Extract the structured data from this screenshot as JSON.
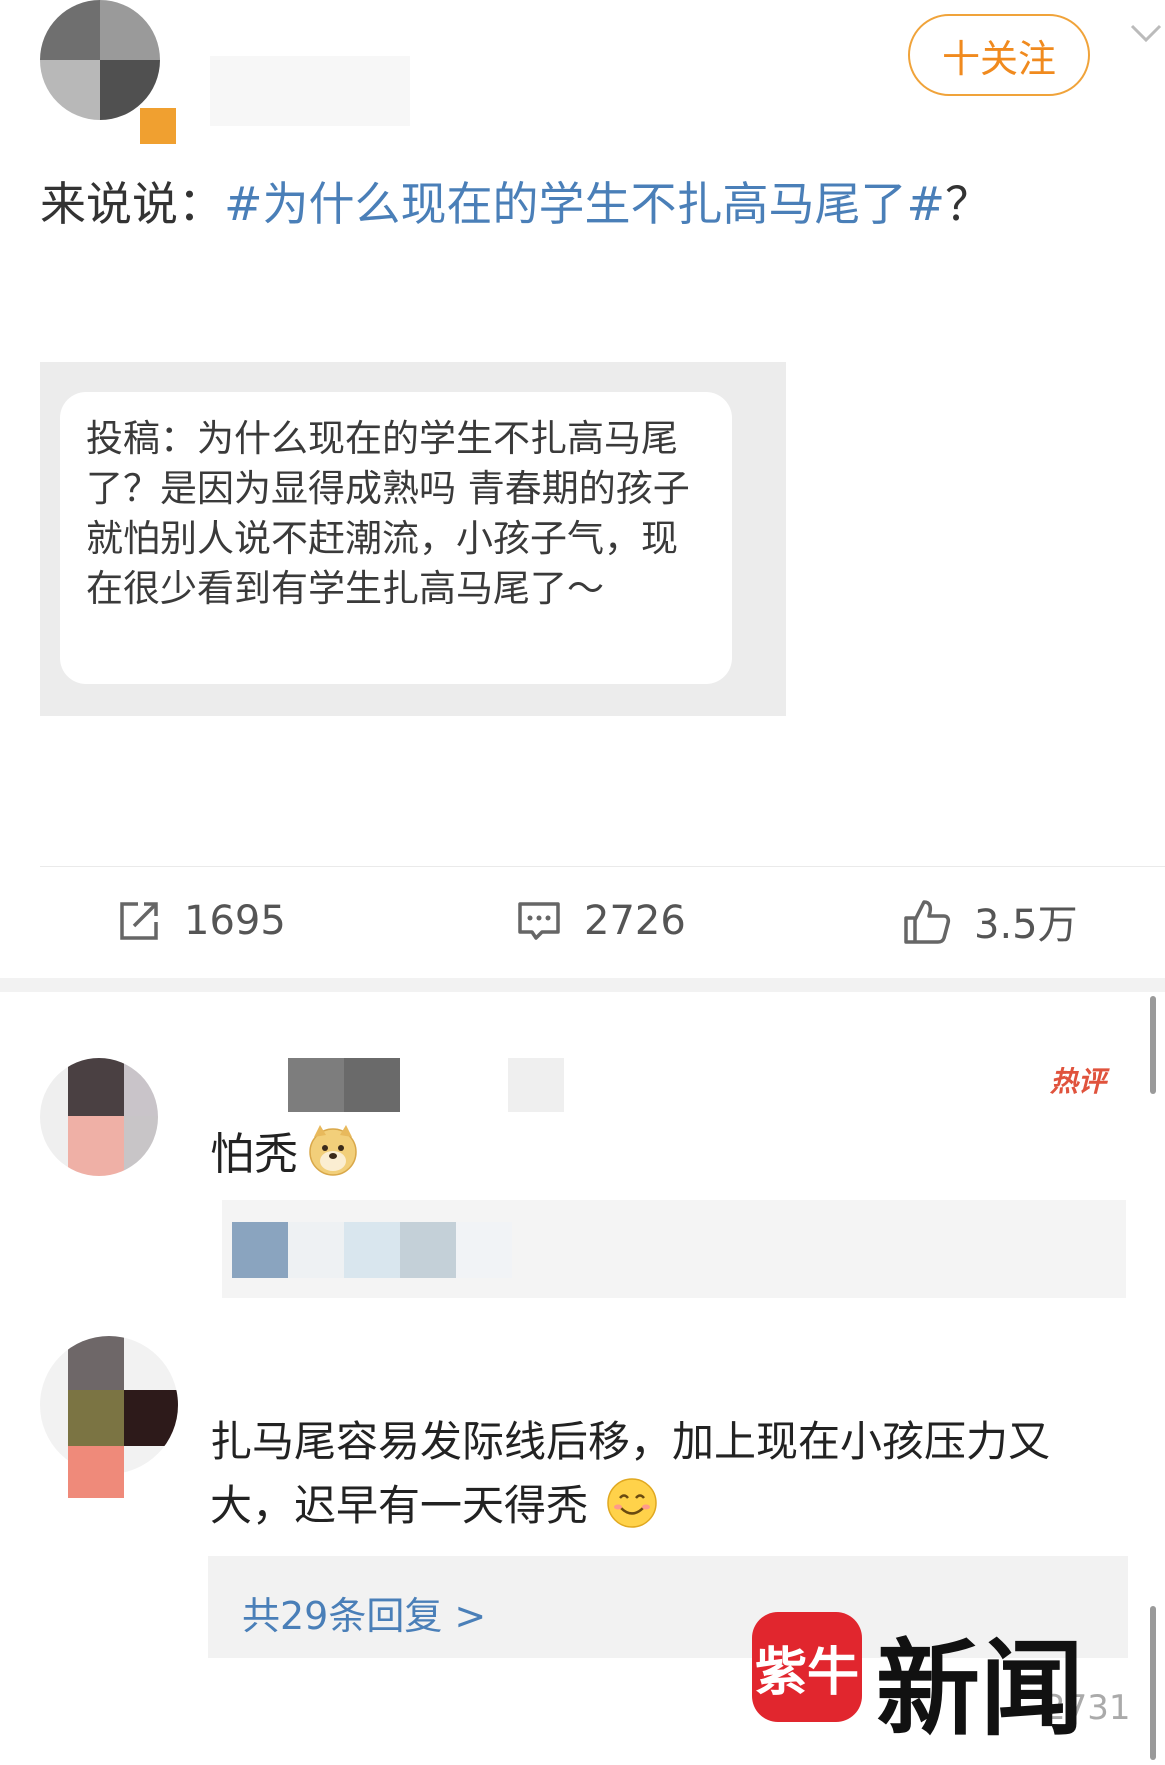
{
  "post": {
    "follow_label": "十关注",
    "text_prefix": "来说说：",
    "hashtag": "#为什么现在的学生不扎高马尾了#",
    "text_suffix": "？",
    "quote_text": "投稿：为什么现在的学生不扎高马尾了？是因为显得成熟吗 青春期的孩子就怕别人说不赶潮流，小孩子气，现在很少看到有学生扎高马尾了～"
  },
  "actions": {
    "repost_count": "1695",
    "comment_count": "2726",
    "like_count": "3.5万"
  },
  "comments": [
    {
      "badge": "热评",
      "text": "怕秃",
      "emoji": "doge"
    },
    {
      "text": "扎马尾容易发际线后移，加上现在小孩压力又大，迟早有一天得秃",
      "emoji": "smile",
      "reply_link": "共29条回复 >",
      "like_count": "2731"
    }
  ],
  "watermark": {
    "logo_mark": "紫牛",
    "brand": "新闻"
  },
  "colors": {
    "accent_orange": "#f08a1e",
    "link_blue": "#4a7fb8",
    "hot_red": "#e0533d",
    "logo_red": "#e1262e"
  }
}
